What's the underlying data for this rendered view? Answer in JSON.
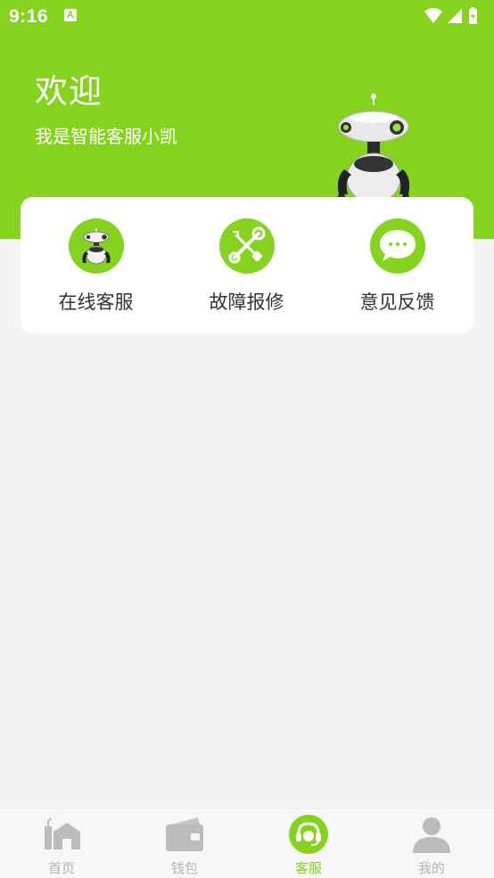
{
  "status_bar": {
    "time": "9:16",
    "notification_letter": "A"
  },
  "hero": {
    "title": "欢迎",
    "subtitle": "我是智能客服小凯"
  },
  "services": [
    {
      "label": "在线客服",
      "icon": "robot-icon"
    },
    {
      "label": "故障报修",
      "icon": "wrench-screwdriver-icon"
    },
    {
      "label": "意见反馈",
      "icon": "chat-bubble-icon"
    }
  ],
  "tabs": [
    {
      "label": "首页",
      "icon": "home-icon",
      "active": false
    },
    {
      "label": "钱包",
      "icon": "wallet-icon",
      "active": false
    },
    {
      "label": "客服",
      "icon": "headset-icon",
      "active": true
    },
    {
      "label": "我的",
      "icon": "person-icon",
      "active": false
    }
  ],
  "colors": {
    "accent": "#86d31f",
    "background": "#f4f4f4",
    "inactive": "#b5b5b5"
  }
}
